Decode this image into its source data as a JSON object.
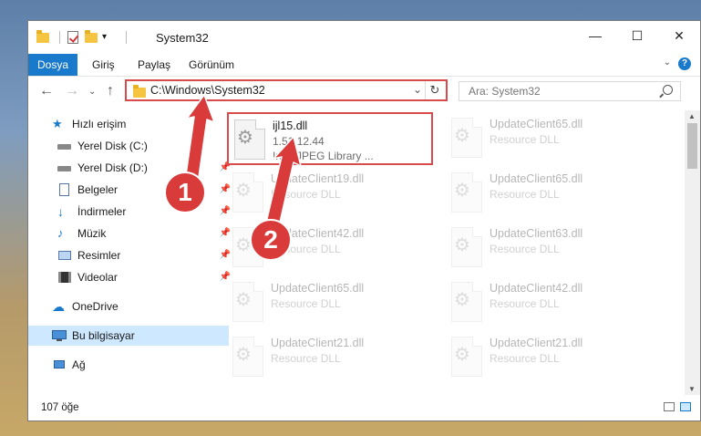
{
  "window": {
    "title": "System32",
    "minimize": "—",
    "maximize": "☐",
    "close": "✕"
  },
  "ribbon": {
    "tabs": [
      "Dosya",
      "Giriş",
      "Paylaş",
      "Görünüm"
    ],
    "help": "?"
  },
  "nav": {
    "address": "C:\\Windows\\System32",
    "search_placeholder": "Ara: System32"
  },
  "sidebar": {
    "items": [
      {
        "label": "Hızlı erişim",
        "icon": "star-icon"
      },
      {
        "label": "Yerel Disk (C:)",
        "icon": "drive-icon"
      },
      {
        "label": "Yerel Disk (D:)",
        "icon": "drive-icon"
      },
      {
        "label": "Belgeler",
        "icon": "documents-icon"
      },
      {
        "label": "İndirmeler",
        "icon": "download-icon"
      },
      {
        "label": "Müzik",
        "icon": "music-icon"
      },
      {
        "label": "Resimler",
        "icon": "pictures-icon"
      },
      {
        "label": "Videolar",
        "icon": "video-icon"
      },
      {
        "label": "OneDrive",
        "icon": "cloud-icon"
      },
      {
        "label": "Bu bilgisayar",
        "icon": "computer-icon"
      },
      {
        "label": "Ağ",
        "icon": "network-icon"
      }
    ]
  },
  "files": [
    {
      "name": "ijl15.dll",
      "line2": "1.51.12.44",
      "line3": "Intel JPEG Library ..."
    },
    {
      "name": "UpdateClient65.dll",
      "line2": "Resource DLL"
    },
    {
      "name": "UpdateClient19.dll",
      "line2": "Resource DLL"
    },
    {
      "name": "UpdateClient65.dll",
      "line2": "Resource DLL"
    },
    {
      "name": "UpdateClient42.dll",
      "line2": "Resource DLL"
    },
    {
      "name": "UpdateClient63.dll",
      "line2": "Resource DLL"
    },
    {
      "name": "UpdateClient65.dll",
      "line2": "Resource DLL"
    },
    {
      "name": "UpdateClient42.dll",
      "line2": "Resource DLL"
    },
    {
      "name": "UpdateClient21.dll",
      "line2": "Resource DLL"
    },
    {
      "name": "UpdateClient21.dll",
      "line2": "Resource DLL"
    }
  ],
  "status": {
    "count": "107 öğe"
  },
  "annotations": {
    "step1": "1",
    "step2": "2"
  },
  "colors": {
    "accent": "#1979ca",
    "highlight": "#d94a4a",
    "selected": "#cde8ff"
  }
}
